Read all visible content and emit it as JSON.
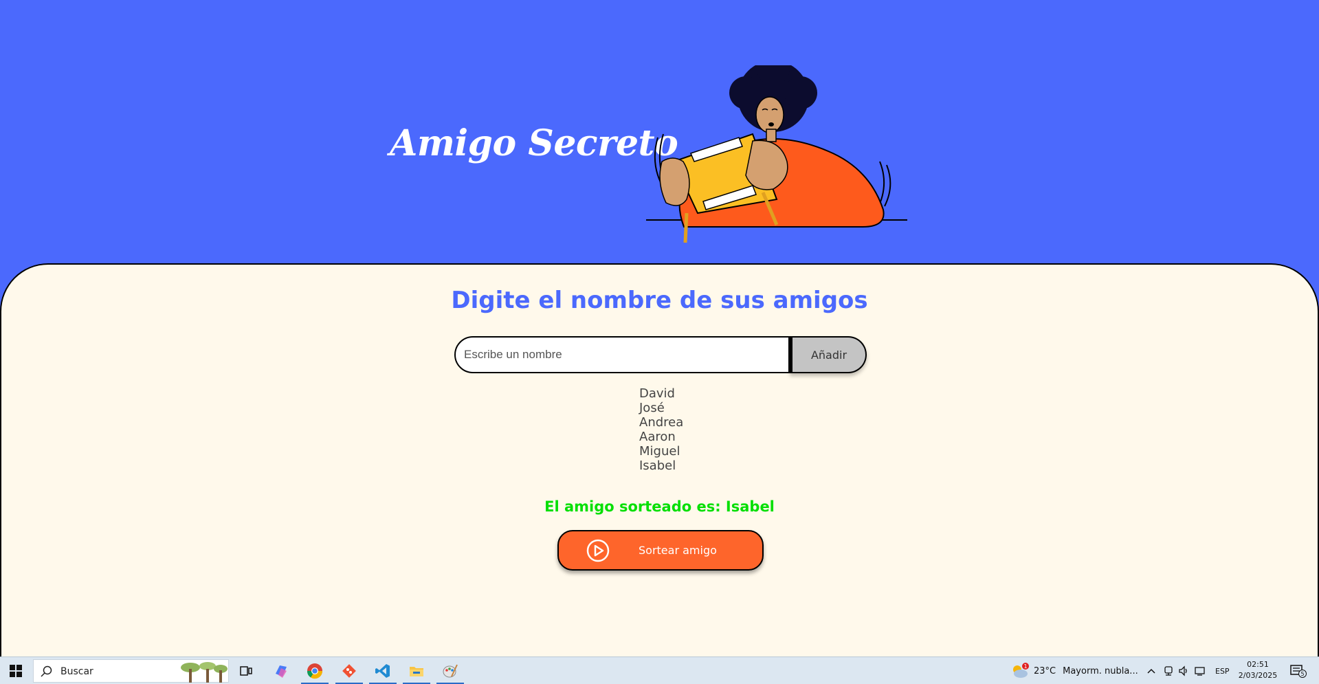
{
  "app": {
    "title": "Amigo Secreto"
  },
  "main": {
    "section_title": "Digite el nombre de sus amigos",
    "input": {
      "placeholder": "Escribe un nombre",
      "value": ""
    },
    "add_button_label": "Añadir",
    "friends": [
      "David",
      "José",
      "Andrea",
      "Aaron",
      "Miguel",
      "Isabel"
    ],
    "result_text": "El amigo sorteado es: Isabel",
    "draw_button_label": "Sortear amigo"
  },
  "taskbar": {
    "search_placeholder": "Buscar",
    "weather_temp": "23°C",
    "weather_desc": "Mayorm. nubla...",
    "weather_badge": "1",
    "language": "ESP",
    "time": "02:51",
    "date": "2/03/2025",
    "notification_count": "5",
    "pinned_apps": [
      "task-view-icon",
      "copilot-icon",
      "chrome-icon",
      "git-icon",
      "vscode-icon",
      "file-explorer-icon",
      "paint-icon"
    ]
  },
  "colors": {
    "banner": "#4b69fd",
    "card": "#fff9eb",
    "accent_orange": "#fe652b",
    "title_blue": "#4b69fd",
    "result_green": "#05df05"
  }
}
